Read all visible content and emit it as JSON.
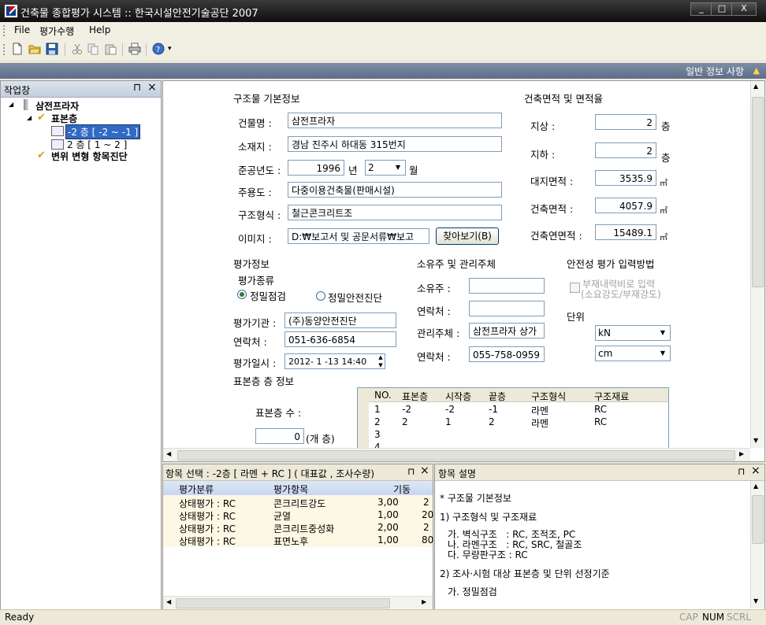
{
  "window": {
    "title": "건축물 종합평가 시스템 :: 한국시설안전기술공단 2007",
    "min": "_",
    "max": "□",
    "close": "X"
  },
  "menu": [
    "File",
    "평가수행",
    "Help"
  ],
  "infobar": "일반 정보 사항",
  "left_panel": {
    "title": "작업창",
    "pin": "ᵖ",
    "close": "×",
    "tree": {
      "root": "삼전프라자",
      "group": "표본층",
      "items": [
        "-2 층 [ -2 ~ -1 ]",
        "2 층 [ 1 ~ 2 ]"
      ],
      "other": "변위 변형 항목진단"
    }
  },
  "struct": {
    "heading": "구조물 기본정보",
    "building_name_label": "건물명 :",
    "building_name": "삼전프라자",
    "address_label": "소재지 :",
    "address": "경남 진주시 하대동 315번지",
    "year_label": "준공년도 :",
    "year": "1996",
    "year_unit": "년",
    "month": "2",
    "month_unit": "월",
    "use_label": "주용도 :",
    "use": "다중이용건축물(판매시설)",
    "form_label": "구조형식 :",
    "form": "철근콘크리트조",
    "image_label": "이미지 :",
    "image_path": "D:₩보고서 및 공문서류₩보고",
    "browse": "찾아보기(B)"
  },
  "area": {
    "heading": "건축면적 및 면적율",
    "above_label": "지상 :",
    "above": "2",
    "above_unit": "층",
    "below_label": "지하 :",
    "below": "2",
    "below_unit": "층",
    "site_label": "대지면적 :",
    "site": "3535.9",
    "site_unit": "㎡",
    "building_label": "건축면적 :",
    "building": "4057.9",
    "building_unit": "㎡",
    "total_label": "건축연면적 :",
    "total": "15489.1",
    "total_unit": "㎡"
  },
  "eval": {
    "heading": "평가정보",
    "type_label": "평가종류",
    "radio1": "정밀점검",
    "radio2": "정밀안전진단",
    "agency_label": "평가기관 :",
    "agency": "(주)동양안전진단",
    "contact_label": "연락처 :",
    "contact": "051-636-6854",
    "date_label": "평가일시 :",
    "date": "2012- 1 -13 14:40"
  },
  "owner": {
    "heading": "소유주 및 관리주체",
    "owner_label": "소유주 :",
    "owner": "",
    "owner_contact_label": "연락처 :",
    "owner_contact": "",
    "manager_label": "관리주체 :",
    "manager": "삼전프라자 상가",
    "manager_contact_label": "연락처 :",
    "manager_contact": "055-758-0959"
  },
  "safety": {
    "heading": "안전성 평가 입력방법",
    "checkbox_label_1": "부재내력비로 입력",
    "checkbox_label_2": "(소요강도/부재강도)",
    "unit_label": "단위",
    "unit_force": "kN",
    "unit_length": "cm"
  },
  "sample": {
    "heading": "표본층 층 정보",
    "count_label": "표본층 수 :",
    "count": "0",
    "count_unit": "(개 층)",
    "columns": [
      "NO.",
      "표본층",
      "시작층",
      "끝층",
      "구조형식",
      "구조재료"
    ],
    "rows": [
      [
        "1",
        "-2",
        "-2",
        "-1",
        "라멘",
        "RC"
      ],
      [
        "2",
        "2",
        "1",
        "2",
        "라멘",
        "RC"
      ],
      [
        "3",
        "",
        "",
        "",
        "",
        ""
      ],
      [
        "4",
        "",
        "",
        "",
        "",
        ""
      ]
    ]
  },
  "items_panel": {
    "title": "항목 선택 :  -2층 [ 라멘 + RC ] ( 대표값 ,  조사수량)",
    "pin": "ᵖ",
    "close": "×",
    "columns": [
      "평가분류",
      "평가항목",
      "기동"
    ],
    "rows": [
      [
        "상태평가 : RC",
        "콘크리트강도",
        "3,00",
        "2"
      ],
      [
        "상태평가 : RC",
        "균열",
        "1,00",
        "20"
      ],
      [
        "상태평가 : RC",
        "콘크리트중성화",
        "2,00",
        "2"
      ],
      [
        "상태평가 : RC",
        "표면노후",
        "1,00",
        "80"
      ]
    ]
  },
  "desc_panel": {
    "title": "항목 설명",
    "pin": "ᵖ",
    "close": "×",
    "lines": [
      "* 구조물 기본정보",
      "1) 구조형식 및 구조재료",
      "가. 벽식구조   : RC, 조적조, PC",
      "나. 라멘구조   : RC, SRC, 철골조",
      "다. 무량판구조 : RC",
      "2) 조사·시험 대상 표본층 및 단위 선정기준",
      "가. 정밀점검"
    ]
  },
  "status": {
    "ready": "Ready",
    "cap": "CAP",
    "num": "NUM",
    "scrl": "SCRL"
  }
}
